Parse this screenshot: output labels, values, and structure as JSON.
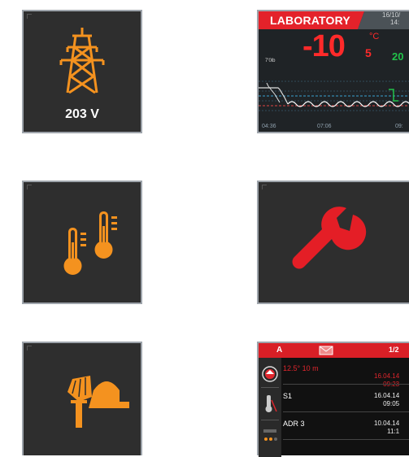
{
  "tiles": {
    "power": {
      "value": "203 V",
      "icon": "power-pylon-icon",
      "color": "#f4921f"
    },
    "temperature": {
      "icon": "thermometers-icon",
      "color": "#f4921f"
    },
    "cleaning": {
      "icon": "broom-dustpan-icon",
      "color": "#f4921f"
    },
    "service": {
      "icon": "wrench-icon",
      "color": "#e41e26"
    },
    "laboratory": {
      "title": "LABORATORY",
      "date_line1": "16/10/",
      "date_line2": "14:",
      "temperature": "-10",
      "temperature_decimal": "5",
      "unit": "°C",
      "secondary_reading": "20",
      "axis_label": "7'0lb",
      "times": [
        "04:36",
        "07:06",
        "09:"
      ]
    },
    "events": {
      "header_label": "A",
      "page": "1/2",
      "rows": [
        {
          "left": "12.5°   10 m",
          "right_line1": "16.04.14",
          "right_line2": "09:23",
          "highlight": true
        },
        {
          "left": "S1",
          "right_line1": "16.04.14",
          "right_line2": "09:05",
          "highlight": false
        },
        {
          "left": "ADR 3",
          "right_line1": "10.04.14",
          "right_line2": "11:1",
          "highlight": false
        }
      ]
    }
  }
}
